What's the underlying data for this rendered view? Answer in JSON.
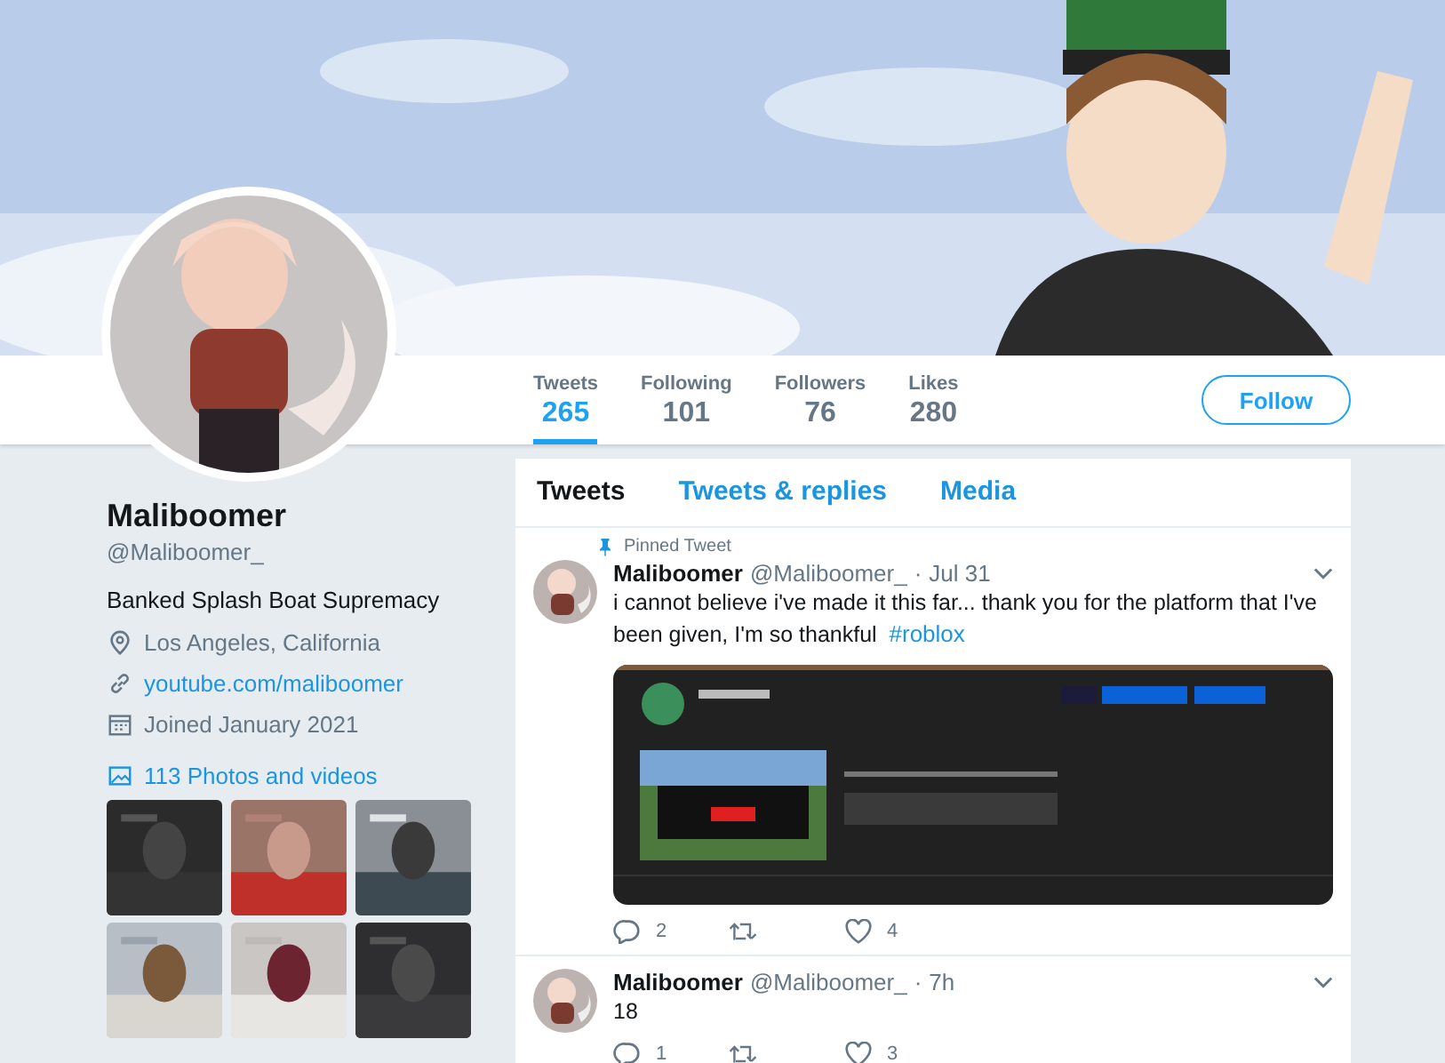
{
  "profile_nav": {
    "stats": [
      {
        "label": "Tweets",
        "value": "265",
        "selected": true
      },
      {
        "label": "Following",
        "value": "101",
        "selected": false
      },
      {
        "label": "Followers",
        "value": "76",
        "selected": false
      },
      {
        "label": "Likes",
        "value": "280",
        "selected": false
      }
    ],
    "follow_button": "Follow"
  },
  "profile": {
    "name": "Maliboomer",
    "handle": "@Maliboomer_",
    "bio": "Banked Splash Boat Supremacy",
    "details": [
      {
        "kind": "location",
        "text": "Los Angeles, California"
      },
      {
        "kind": "link",
        "text": "youtube.com/maliboomer"
      },
      {
        "kind": "joined",
        "text": "Joined January 2021"
      }
    ],
    "photos_link": "113 Photos and videos"
  },
  "timeline": {
    "tabs": [
      {
        "label": "Tweets",
        "selected": true
      },
      {
        "label": "Tweets & replies",
        "selected": false
      },
      {
        "label": "Media",
        "selected": false
      }
    ],
    "tweets": [
      {
        "pinned_label": "Pinned Tweet",
        "name": "Maliboomer",
        "handle": "@Maliboomer_",
        "separator": "·",
        "time": "Jul 31",
        "text": "i cannot believe i've made it this far... thank you for the platform that I've been given, I'm so thankful",
        "hashtag": "#roblox",
        "replies": "2",
        "likes": "4"
      },
      {
        "name": "Maliboomer",
        "handle": "@Maliboomer_",
        "separator": "·",
        "time": "7h",
        "text": "18",
        "replies": "1",
        "likes": "3"
      }
    ]
  }
}
